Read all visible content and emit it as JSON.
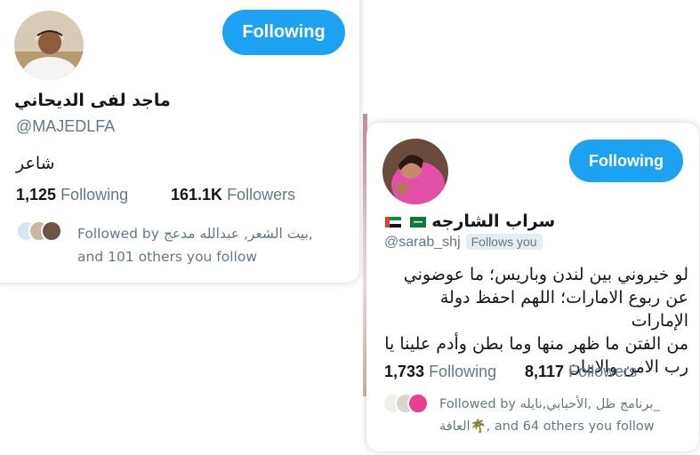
{
  "card1": {
    "follow_label": "Following",
    "name": "ماجد لفى الديحاني",
    "handle": "@MAJEDLFA",
    "bio": "شاعر",
    "following_count": "1,125",
    "following_label": "Following",
    "followers_count": "161.1K",
    "followers_label": "Followers",
    "followed_by_line1": "Followed by بيت الشعر, عبدالله مدعج,",
    "followed_by_line2": "and 101 others you follow"
  },
  "card2": {
    "follow_label": "Following",
    "name": "سراب الشارجه",
    "handle": "@sarab_shj",
    "follows_you": "Follows you",
    "bio_lines": [
      "لو خيروني بين لندن وباريس؛ ما عوضوني",
      "عن ربوع الامارات؛ اللهم احفظ دولة الإمارات",
      "من الفتن ما ظهر منها وما بطن وأدم علينا يا",
      "رب الامن والامان"
    ],
    "following_count": "1,733",
    "following_label": "Following",
    "followers_count": "8,117",
    "followers_label": "Followers",
    "followed_by_line1": "Followed by برنامج ظل ,الأحبابي,نايله_",
    "followed_by_line2": "العافة🌴, and 64 others you follow"
  },
  "colors": {
    "accent": "#1da1f2",
    "muted": "#657786",
    "text": "#14171a"
  },
  "icons": [
    "uae-flag-icon",
    "saudi-flag-icon"
  ]
}
